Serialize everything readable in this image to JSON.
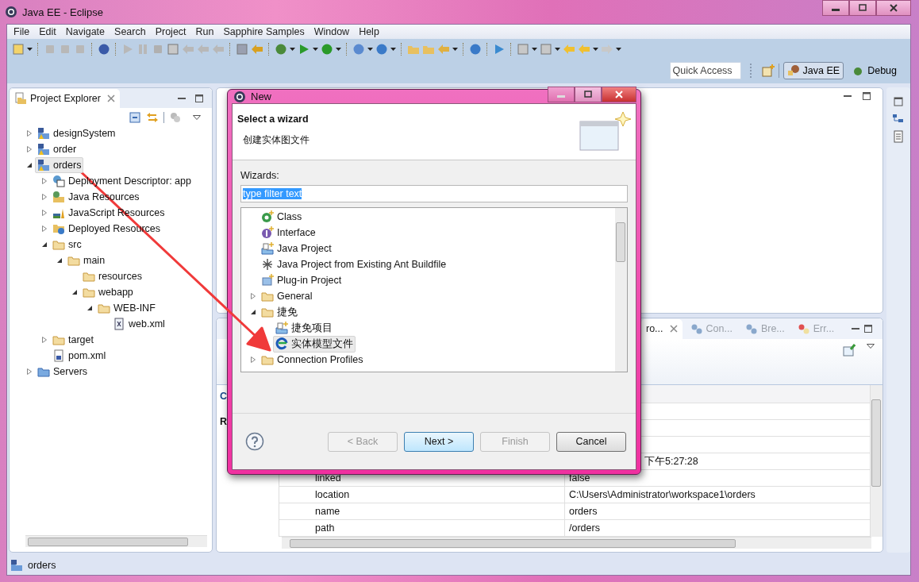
{
  "window": {
    "title": "Java EE - Eclipse"
  },
  "menu": [
    "File",
    "Edit",
    "Navigate",
    "Search",
    "Project",
    "Run",
    "Sapphire Samples",
    "Window",
    "Help"
  ],
  "quick_access": {
    "placeholder": "Quick Access"
  },
  "perspectives": [
    {
      "label": "Java EE",
      "selected": true
    },
    {
      "label": "Debug",
      "selected": false
    }
  ],
  "project_explorer": {
    "title": "Project Explorer",
    "tree": [
      {
        "label": "designSystem",
        "kind": "project",
        "expandable": true,
        "expanded": false,
        "selected": false
      },
      {
        "label": "order",
        "kind": "project",
        "expandable": true,
        "expanded": false,
        "selected": false
      },
      {
        "label": "orders",
        "kind": "project",
        "expandable": true,
        "expanded": true,
        "selected": true,
        "children": [
          {
            "label": "Deployment Descriptor: app",
            "kind": "descriptor",
            "expandable": true,
            "expanded": false,
            "selected": false
          },
          {
            "label": "Java Resources",
            "kind": "java-resources",
            "expandable": true,
            "expanded": false,
            "selected": false
          },
          {
            "label": "JavaScript Resources",
            "kind": "js-resources",
            "expandable": true,
            "expanded": false,
            "selected": false
          },
          {
            "label": "Deployed Resources",
            "kind": "deployed-resources",
            "expandable": true,
            "expanded": false,
            "selected": false
          },
          {
            "label": "src",
            "kind": "folder",
            "expandable": true,
            "expanded": true,
            "selected": false,
            "children": [
              {
                "label": "main",
                "kind": "folder",
                "expandable": true,
                "expanded": true,
                "selected": false,
                "children": [
                  {
                    "label": "resources",
                    "kind": "folder",
                    "expandable": false,
                    "selected": false
                  },
                  {
                    "label": "webapp",
                    "kind": "folder",
                    "expandable": true,
                    "expanded": true,
                    "selected": false,
                    "children": [
                      {
                        "label": "WEB-INF",
                        "kind": "folder",
                        "expandable": true,
                        "expanded": true,
                        "selected": false,
                        "children": [
                          {
                            "label": "web.xml",
                            "kind": "xml-file",
                            "expandable": false,
                            "selected": false
                          }
                        ]
                      }
                    ]
                  }
                ]
              }
            ]
          },
          {
            "label": "target",
            "kind": "folder",
            "expandable": true,
            "expanded": false,
            "selected": false
          },
          {
            "label": "pom.xml",
            "kind": "maven-file",
            "expandable": false,
            "selected": false
          }
        ]
      },
      {
        "label": "Servers",
        "kind": "server-folder",
        "expandable": true,
        "expanded": false,
        "selected": false
      }
    ]
  },
  "properties_view": {
    "tabs": [
      {
        "label": "ro...",
        "selected": true
      },
      {
        "label": "Con...",
        "selected": false
      },
      {
        "label": "Bre...",
        "selected": false
      },
      {
        "label": "Err...",
        "selected": false
      }
    ],
    "categories": [
      "C",
      "R"
    ],
    "timestamp_value": "下午5:27:28",
    "rows": [
      {
        "property": "linked",
        "value": "false"
      },
      {
        "property": "location",
        "value": "C:\\Users\\Administrator\\workspace1\\orders"
      },
      {
        "property": "name",
        "value": "orders"
      },
      {
        "property": "path",
        "value": "/orders"
      }
    ]
  },
  "status_bar": {
    "text": "orders"
  },
  "dialog": {
    "title": "New",
    "heading": "Select a wizard",
    "description": "创建实体图文件",
    "wizards_label": "Wizards:",
    "filter": {
      "value": "type filter text"
    },
    "tree": [
      {
        "label": "Class",
        "kind": "class",
        "expandable": false,
        "selected": false
      },
      {
        "label": "Interface",
        "kind": "interface",
        "expandable": false,
        "selected": false
      },
      {
        "label": "Java Project",
        "kind": "java-project",
        "expandable": false,
        "selected": false
      },
      {
        "label": "Java Project from Existing Ant Buildfile",
        "kind": "ant-project",
        "expandable": false,
        "selected": false
      },
      {
        "label": "Plug-in Project",
        "kind": "plugin-project",
        "expandable": false,
        "selected": false
      },
      {
        "label": "General",
        "kind": "folder",
        "expandable": true,
        "expanded": false,
        "selected": false
      },
      {
        "label": "捷免",
        "kind": "folder",
        "expandable": true,
        "expanded": true,
        "selected": false,
        "children": [
          {
            "label": "捷免项目",
            "kind": "java-project",
            "expandable": false,
            "selected": false
          },
          {
            "label": "实体模型文件",
            "kind": "entity-model",
            "expandable": false,
            "selected": true
          }
        ]
      },
      {
        "label": "Connection Profiles",
        "kind": "folder",
        "expandable": true,
        "expanded": false,
        "selected": false
      }
    ],
    "buttons": [
      {
        "label": "< Back",
        "disabled": true,
        "default": false
      },
      {
        "label": "Next >",
        "disabled": false,
        "default": true
      },
      {
        "label": "Finish",
        "disabled": true,
        "default": false
      },
      {
        "label": "Cancel",
        "disabled": false,
        "default": false
      }
    ]
  }
}
